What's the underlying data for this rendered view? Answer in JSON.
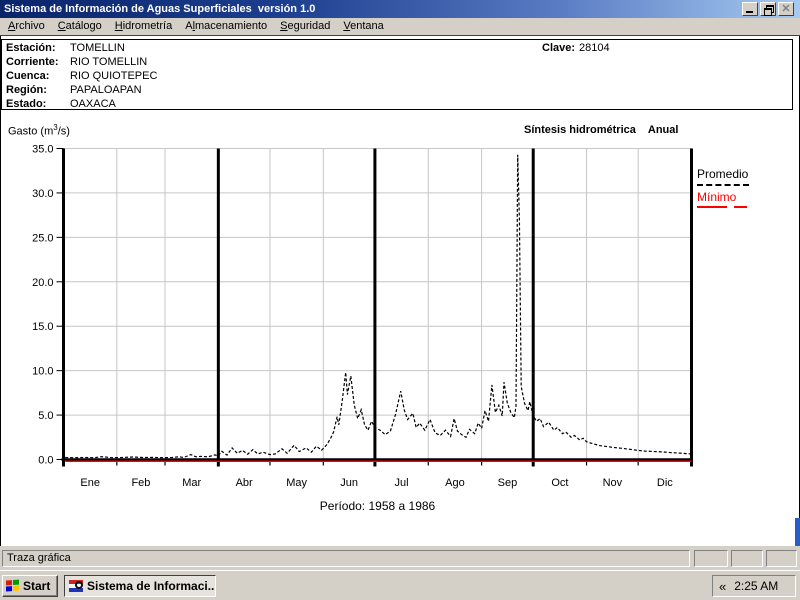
{
  "window": {
    "title": "Sistema de Información de Aguas Superficiales  versión 1.0"
  },
  "menu": {
    "items": [
      {
        "pre": "",
        "accel": "A",
        "post": "rchivo"
      },
      {
        "pre": "",
        "accel": "C",
        "post": "atálogo"
      },
      {
        "pre": "",
        "accel": "H",
        "post": "idrometría"
      },
      {
        "pre": "A",
        "accel": "l",
        "post": "macenamiento"
      },
      {
        "pre": "",
        "accel": "S",
        "post": "eguridad"
      },
      {
        "pre": "",
        "accel": "V",
        "post": "entana"
      }
    ]
  },
  "station": {
    "fields": [
      {
        "label": "Estación:",
        "value": "TOMELLIN"
      },
      {
        "label": "Corriente:",
        "value": "RIO TOMELLIN"
      },
      {
        "label": "Cuenca:",
        "value": "RIO QUIOTEPEC"
      },
      {
        "label": "Región:",
        "value": "PAPALOAPAN"
      },
      {
        "label": "Estado:",
        "value": "OAXACA"
      }
    ],
    "clave_label": "Clave:",
    "clave_value": "28104"
  },
  "chart_header": {
    "gasto_pre": "Gasto (m",
    "gasto_sup": "3",
    "gasto_post": "/s)",
    "title": "Síntesis hidrométrica",
    "subtitle": "Anual"
  },
  "chart_data": {
    "type": "line",
    "title": "Síntesis hidrométrica Anual",
    "ylabel": "Gasto (m3/s)",
    "ylim": [
      0,
      35
    ],
    "yticks": [
      0,
      5,
      10,
      15,
      20,
      25,
      30,
      35
    ],
    "ytick_labels": [
      "0.0",
      "5.0",
      "10.0",
      "15.0",
      "20.0",
      "25.0",
      "30.0",
      "35.0"
    ],
    "months": [
      "Ene",
      "Feb",
      "Mar",
      "Abr",
      "May",
      "Jun",
      "Jul",
      "Ago",
      "Sep",
      "Oct",
      "Nov",
      "Dic"
    ],
    "month_days": [
      31,
      28,
      31,
      30,
      31,
      30,
      31,
      31,
      30,
      31,
      30,
      31
    ],
    "quarter_boundaries": [
      0,
      90,
      181,
      273,
      365
    ],
    "grid": true,
    "legend_position": "right",
    "period_label": "Período: 1958 a 1986",
    "series": [
      {
        "name": "Promedio",
        "color": "#000000",
        "style": "dashed",
        "points": [
          [
            1,
            0.22
          ],
          [
            6,
            0.2
          ],
          [
            12,
            0.22
          ],
          [
            18,
            0.2
          ],
          [
            22,
            0.32
          ],
          [
            24,
            0.28
          ],
          [
            28,
            0.2
          ],
          [
            34,
            0.22
          ],
          [
            40,
            0.28
          ],
          [
            46,
            0.22
          ],
          [
            52,
            0.24
          ],
          [
            58,
            0.2
          ],
          [
            63,
            0.22
          ],
          [
            67,
            0.3
          ],
          [
            70,
            0.24
          ],
          [
            74,
            0.55
          ],
          [
            77,
            0.3
          ],
          [
            80,
            0.35
          ],
          [
            84,
            0.3
          ],
          [
            88,
            0.52
          ],
          [
            90,
            0.4
          ],
          [
            92,
            0.92
          ],
          [
            95,
            0.5
          ],
          [
            98,
            1.3
          ],
          [
            101,
            0.7
          ],
          [
            104,
            1.02
          ],
          [
            107,
            0.6
          ],
          [
            110,
            1.1
          ],
          [
            113,
            0.62
          ],
          [
            116,
            0.82
          ],
          [
            120,
            0.55
          ],
          [
            123,
            0.62
          ],
          [
            127,
            1.2
          ],
          [
            130,
            0.7
          ],
          [
            134,
            1.6
          ],
          [
            137,
            0.9
          ],
          [
            141,
            1.3
          ],
          [
            144,
            0.82
          ],
          [
            147,
            1.5
          ],
          [
            150,
            1.05
          ],
          [
            153,
            1.65
          ],
          [
            155,
            2.3
          ],
          [
            157,
            3.1
          ],
          [
            159,
            4.8
          ],
          [
            160,
            3.9
          ],
          [
            162,
            6.6
          ],
          [
            164,
            9.8
          ],
          [
            165,
            7.3
          ],
          [
            167,
            9.4
          ],
          [
            169,
            6.1
          ],
          [
            171,
            4.6
          ],
          [
            173,
            5.6
          ],
          [
            175,
            3.9
          ],
          [
            177,
            3.3
          ],
          [
            179,
            4.3
          ],
          [
            181,
            3.6
          ],
          [
            184,
            3.3
          ],
          [
            187,
            2.8
          ],
          [
            190,
            3.2
          ],
          [
            193,
            5.1
          ],
          [
            196,
            7.7
          ],
          [
            198,
            5.6
          ],
          [
            200,
            4.5
          ],
          [
            203,
            5.2
          ],
          [
            205,
            3.6
          ],
          [
            207,
            4.1
          ],
          [
            210,
            3.3
          ],
          [
            213,
            4.5
          ],
          [
            216,
            3.0
          ],
          [
            219,
            2.7
          ],
          [
            222,
            3.3
          ],
          [
            225,
            2.6
          ],
          [
            227,
            4.6
          ],
          [
            229,
            3.2
          ],
          [
            232,
            2.7
          ],
          [
            234,
            2.5
          ],
          [
            236,
            3.4
          ],
          [
            239,
            2.9
          ],
          [
            241,
            4.1
          ],
          [
            243,
            3.5
          ],
          [
            245,
            5.5
          ],
          [
            247,
            4.3
          ],
          [
            249,
            8.4
          ],
          [
            251,
            5.3
          ],
          [
            253,
            6.1
          ],
          [
            255,
            4.9
          ],
          [
            256,
            8.7
          ],
          [
            258,
            6.3
          ],
          [
            260,
            5.3
          ],
          [
            262,
            4.7
          ],
          [
            263,
            6.0
          ],
          [
            264,
            34.3
          ],
          [
            265,
            27.0
          ],
          [
            266,
            8.2
          ],
          [
            268,
            6.3
          ],
          [
            270,
            5.5
          ],
          [
            271,
            6.5
          ],
          [
            273,
            4.9
          ],
          [
            275,
            4.3
          ],
          [
            277,
            4.6
          ],
          [
            279,
            3.7
          ],
          [
            282,
            4.2
          ],
          [
            285,
            3.3
          ],
          [
            287,
            3.6
          ],
          [
            290,
            2.9
          ],
          [
            292,
            3.1
          ],
          [
            295,
            2.5
          ],
          [
            297,
            2.7
          ],
          [
            300,
            2.2
          ],
          [
            302,
            2.4
          ],
          [
            304,
            2.0
          ],
          [
            308,
            1.75
          ],
          [
            312,
            1.55
          ],
          [
            316,
            1.45
          ],
          [
            320,
            1.35
          ],
          [
            325,
            1.25
          ],
          [
            330,
            1.12
          ],
          [
            334,
            1.02
          ],
          [
            338,
            0.95
          ],
          [
            343,
            0.9
          ],
          [
            348,
            0.85
          ],
          [
            353,
            0.78
          ],
          [
            358,
            0.72
          ],
          [
            362,
            0.66
          ],
          [
            365,
            0.62
          ]
        ]
      },
      {
        "name": "Mínimo",
        "color": "#ff0000",
        "style": "solid",
        "points": [
          [
            1,
            0.05
          ],
          [
            365,
            0.05
          ]
        ]
      }
    ]
  },
  "legend": {
    "items": [
      {
        "label": "Promedio",
        "color": "#000000"
      },
      {
        "label": "Mínimo",
        "color": "#ff0000"
      }
    ]
  },
  "status_bar": {
    "text": "Traza gráfica"
  },
  "taskbar": {
    "start_label": "Start",
    "app_button_label": "Sistema de Informaci...",
    "tray_collapse": "«",
    "clock": "2:25 AM"
  }
}
